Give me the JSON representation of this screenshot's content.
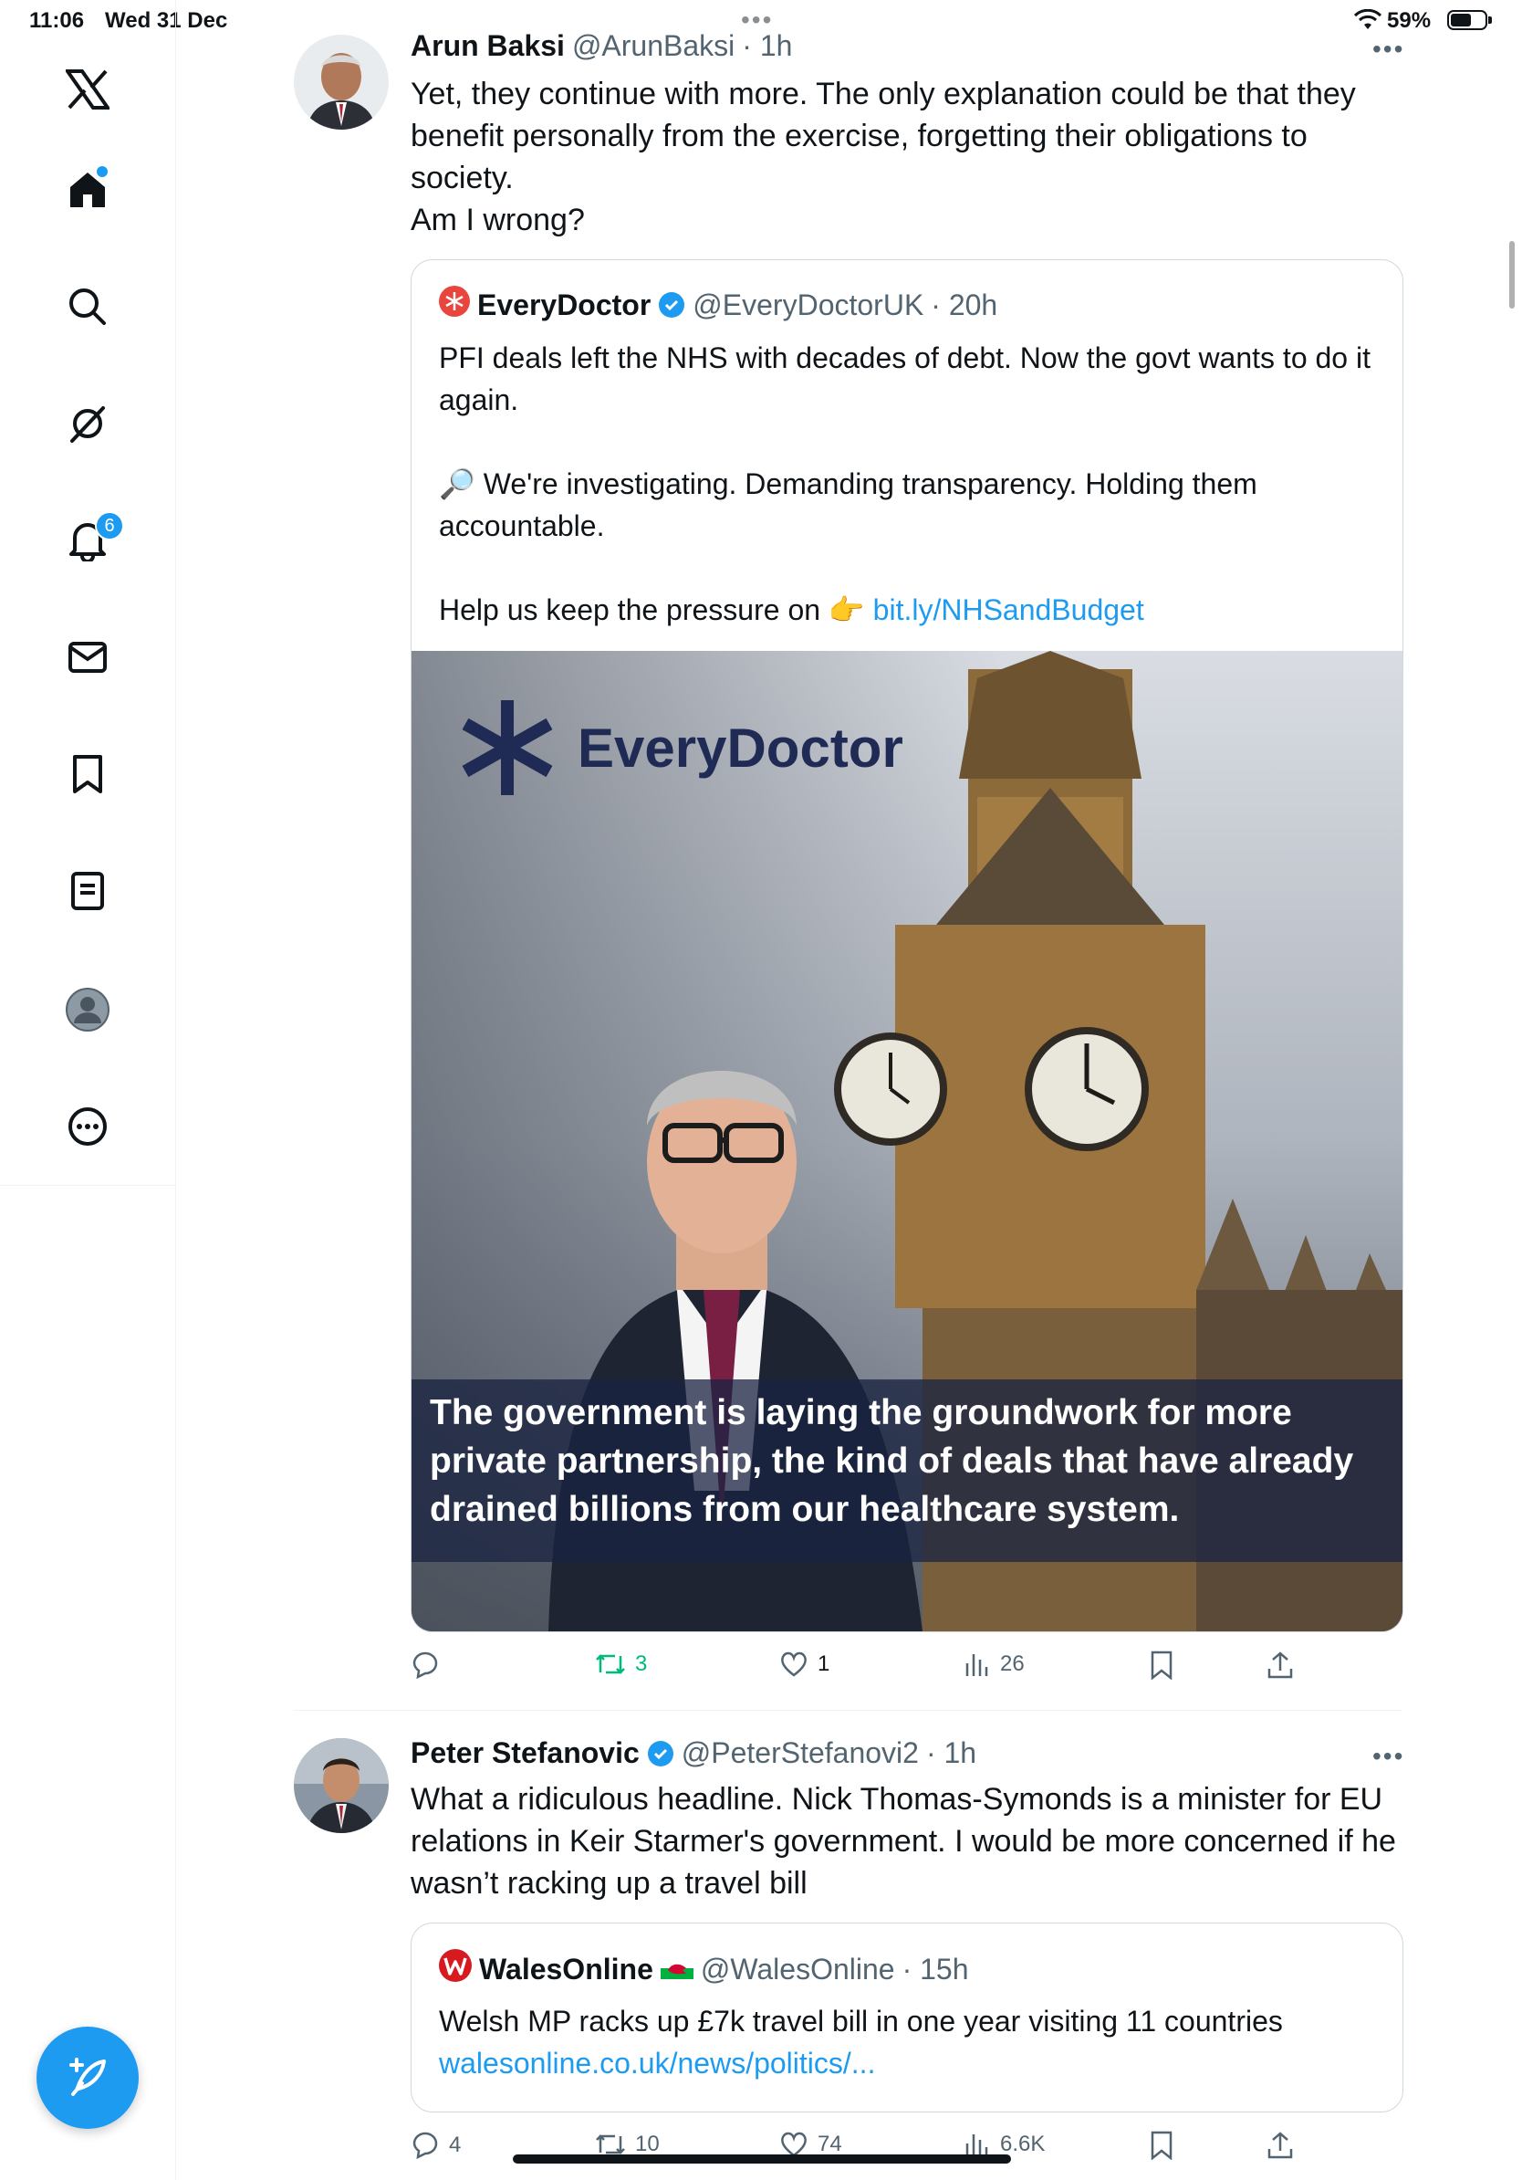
{
  "status_bar": {
    "time": "11:06",
    "date": "Wed 31 Dec",
    "battery": "59%"
  },
  "sidebar": {
    "items": [
      {
        "name": "x-logo"
      },
      {
        "name": "home"
      },
      {
        "name": "search"
      },
      {
        "name": "grok"
      },
      {
        "name": "notifications",
        "badge": "6"
      },
      {
        "name": "messages"
      },
      {
        "name": "bookmarks"
      },
      {
        "name": "lists"
      },
      {
        "name": "profile"
      },
      {
        "name": "more"
      }
    ]
  },
  "tweets": [
    {
      "name": "Arun Baksi",
      "handle": "@ArunBaksi",
      "time": "· 1h",
      "text": "Yet, they continue with more. The only explanation could be that they\nbenefit personally from the exercise, forgetting their obligations to\nsociety.\nAm I wrong?",
      "quote": {
        "name": "EveryDoctor",
        "handle": "@EveryDoctorUK",
        "time": "· 20h",
        "text1": "PFI deals left the NHS with decades of debt. Now the govt wants to do it again.",
        "text2": "🔎 We're investigating. Demanding transparency. Holding them accountable.",
        "text3_prefix": "Help us keep the pressure on 👉 ",
        "link": "bit.ly/NHSandBudget",
        "image": {
          "logo_text": "EveryDoctor",
          "caption": "The government is laying the groundwork for more private partnership, the kind of deals that have already drained billions from our healthcare system."
        }
      },
      "stats": {
        "replies": "",
        "retweets": "3",
        "likes": "1",
        "views": "26"
      }
    },
    {
      "name": "Peter Stefanovic",
      "handle": "@PeterStefanovi2",
      "time": "· 1h",
      "text": "What a ridiculous headline. Nick Thomas-Symonds is a minister for EU\nrelations in Keir Starmer's government. I would be more concerned if he\nwasn’t racking up a travel bill",
      "quote": {
        "name": "WalesOnline",
        "flag": "🏴󠁧󠁢󠁷󠁬󠁳󠁿",
        "handle": "@WalesOnline",
        "time": "· 15h",
        "text1": "Welsh MP racks up £7k travel bill in one year visiting 11 countries",
        "link": "walesonline.co.uk/news/politics/..."
      },
      "stats": {
        "replies": "4",
        "retweets": "10",
        "likes": "74",
        "views": "6.6K"
      }
    }
  ],
  "colors": {
    "accent": "#1d9bf0",
    "retweet_green": "#00ba7c",
    "secondary_text": "#536471"
  }
}
